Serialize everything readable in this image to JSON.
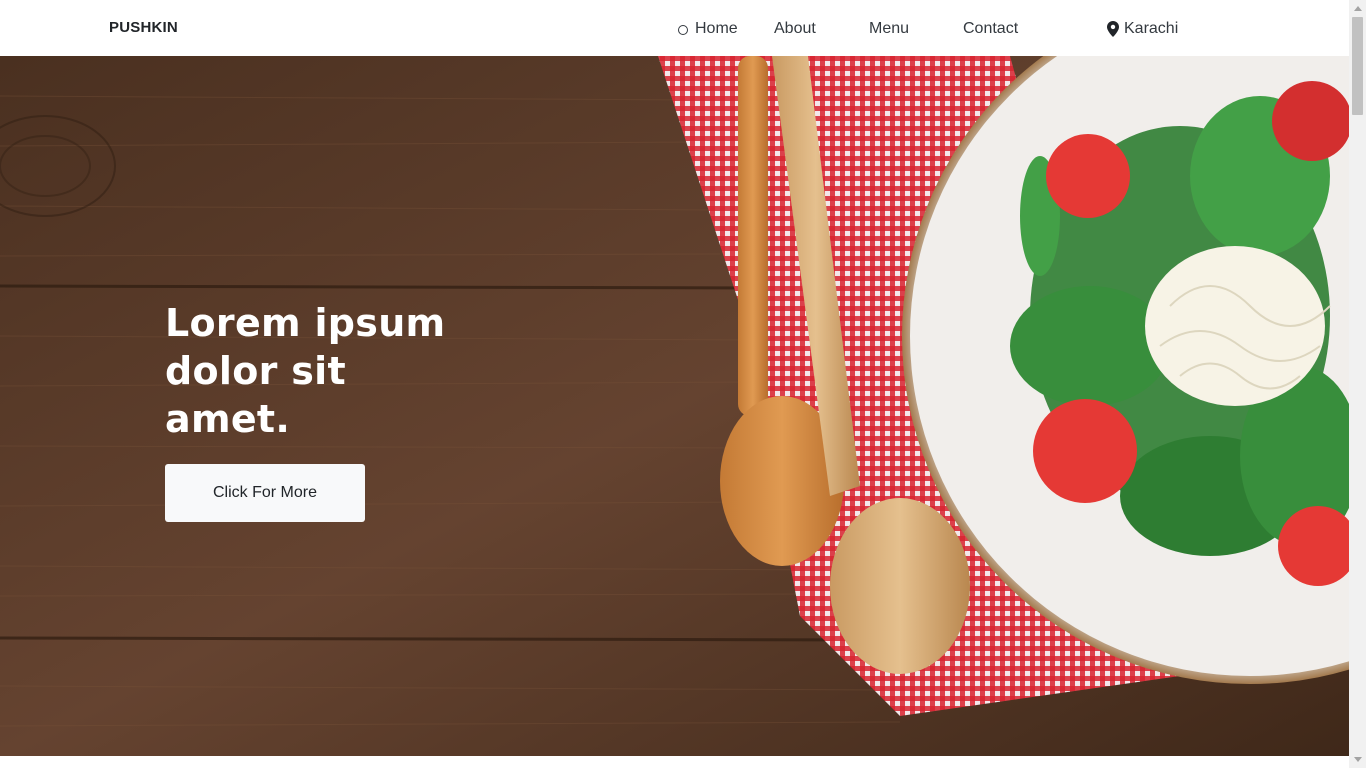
{
  "navbar": {
    "brand": "PUSHKIN",
    "links": [
      "Home",
      "About",
      "Menu",
      "Contact"
    ],
    "location": "Karachi"
  },
  "hero": {
    "heading": "Lorem ipsum dolor sit amet.",
    "button_label": "Click For More"
  },
  "icons": {
    "home": "circle-icon",
    "location": "map-pin-icon"
  },
  "colors": {
    "navbar_bg": "#ffffff",
    "hero_text": "#ffffff",
    "button_bg": "#f8f9fa",
    "wood": "#5a3b26",
    "tablecloth_red": "#d8232f"
  }
}
